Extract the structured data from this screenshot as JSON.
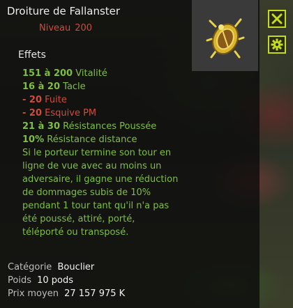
{
  "item": {
    "name": "Droiture de Fallanster",
    "level_label": "Niveau",
    "level_value": "200"
  },
  "effects": {
    "heading": "Effets",
    "list": [
      {
        "value": "151 à 200",
        "label": "Vitalité",
        "kind": "pos"
      },
      {
        "value": "16 à 20",
        "label": "Tacle",
        "kind": "pos"
      },
      {
        "value": "- 20",
        "label": "Fuite",
        "kind": "neg"
      },
      {
        "value": "- 20",
        "label": "Esquive PM",
        "kind": "neg"
      },
      {
        "value": "21 à 30",
        "label": "Résistances Poussée",
        "kind": "pos"
      },
      {
        "value": "10%",
        "label": "Résistance distance",
        "kind": "pos"
      }
    ],
    "description_lines": [
      "Si le porteur termine son tour en",
      "ligne de vue avec au moins un",
      "adversaire, il gagne une réduction",
      "de dommages subis de 10%",
      "pendant 1 tour tant qu'il n'a pas",
      "été poussé, attiré, porté,",
      "téléporté ou transposé."
    ]
  },
  "meta": {
    "category_label": "Catégorie",
    "category_value": "Bouclier",
    "weight_label": "Poids",
    "weight_value": "10 pods",
    "price_label": "Prix moyen",
    "price_value": "27 157 975 K"
  },
  "buttons": {
    "close_icon": "close-icon",
    "settings_icon": "gear-icon"
  },
  "colors": {
    "positive": "#7fbf3f",
    "negative": "#d24a3c",
    "button_border": "#c3dc1e"
  }
}
